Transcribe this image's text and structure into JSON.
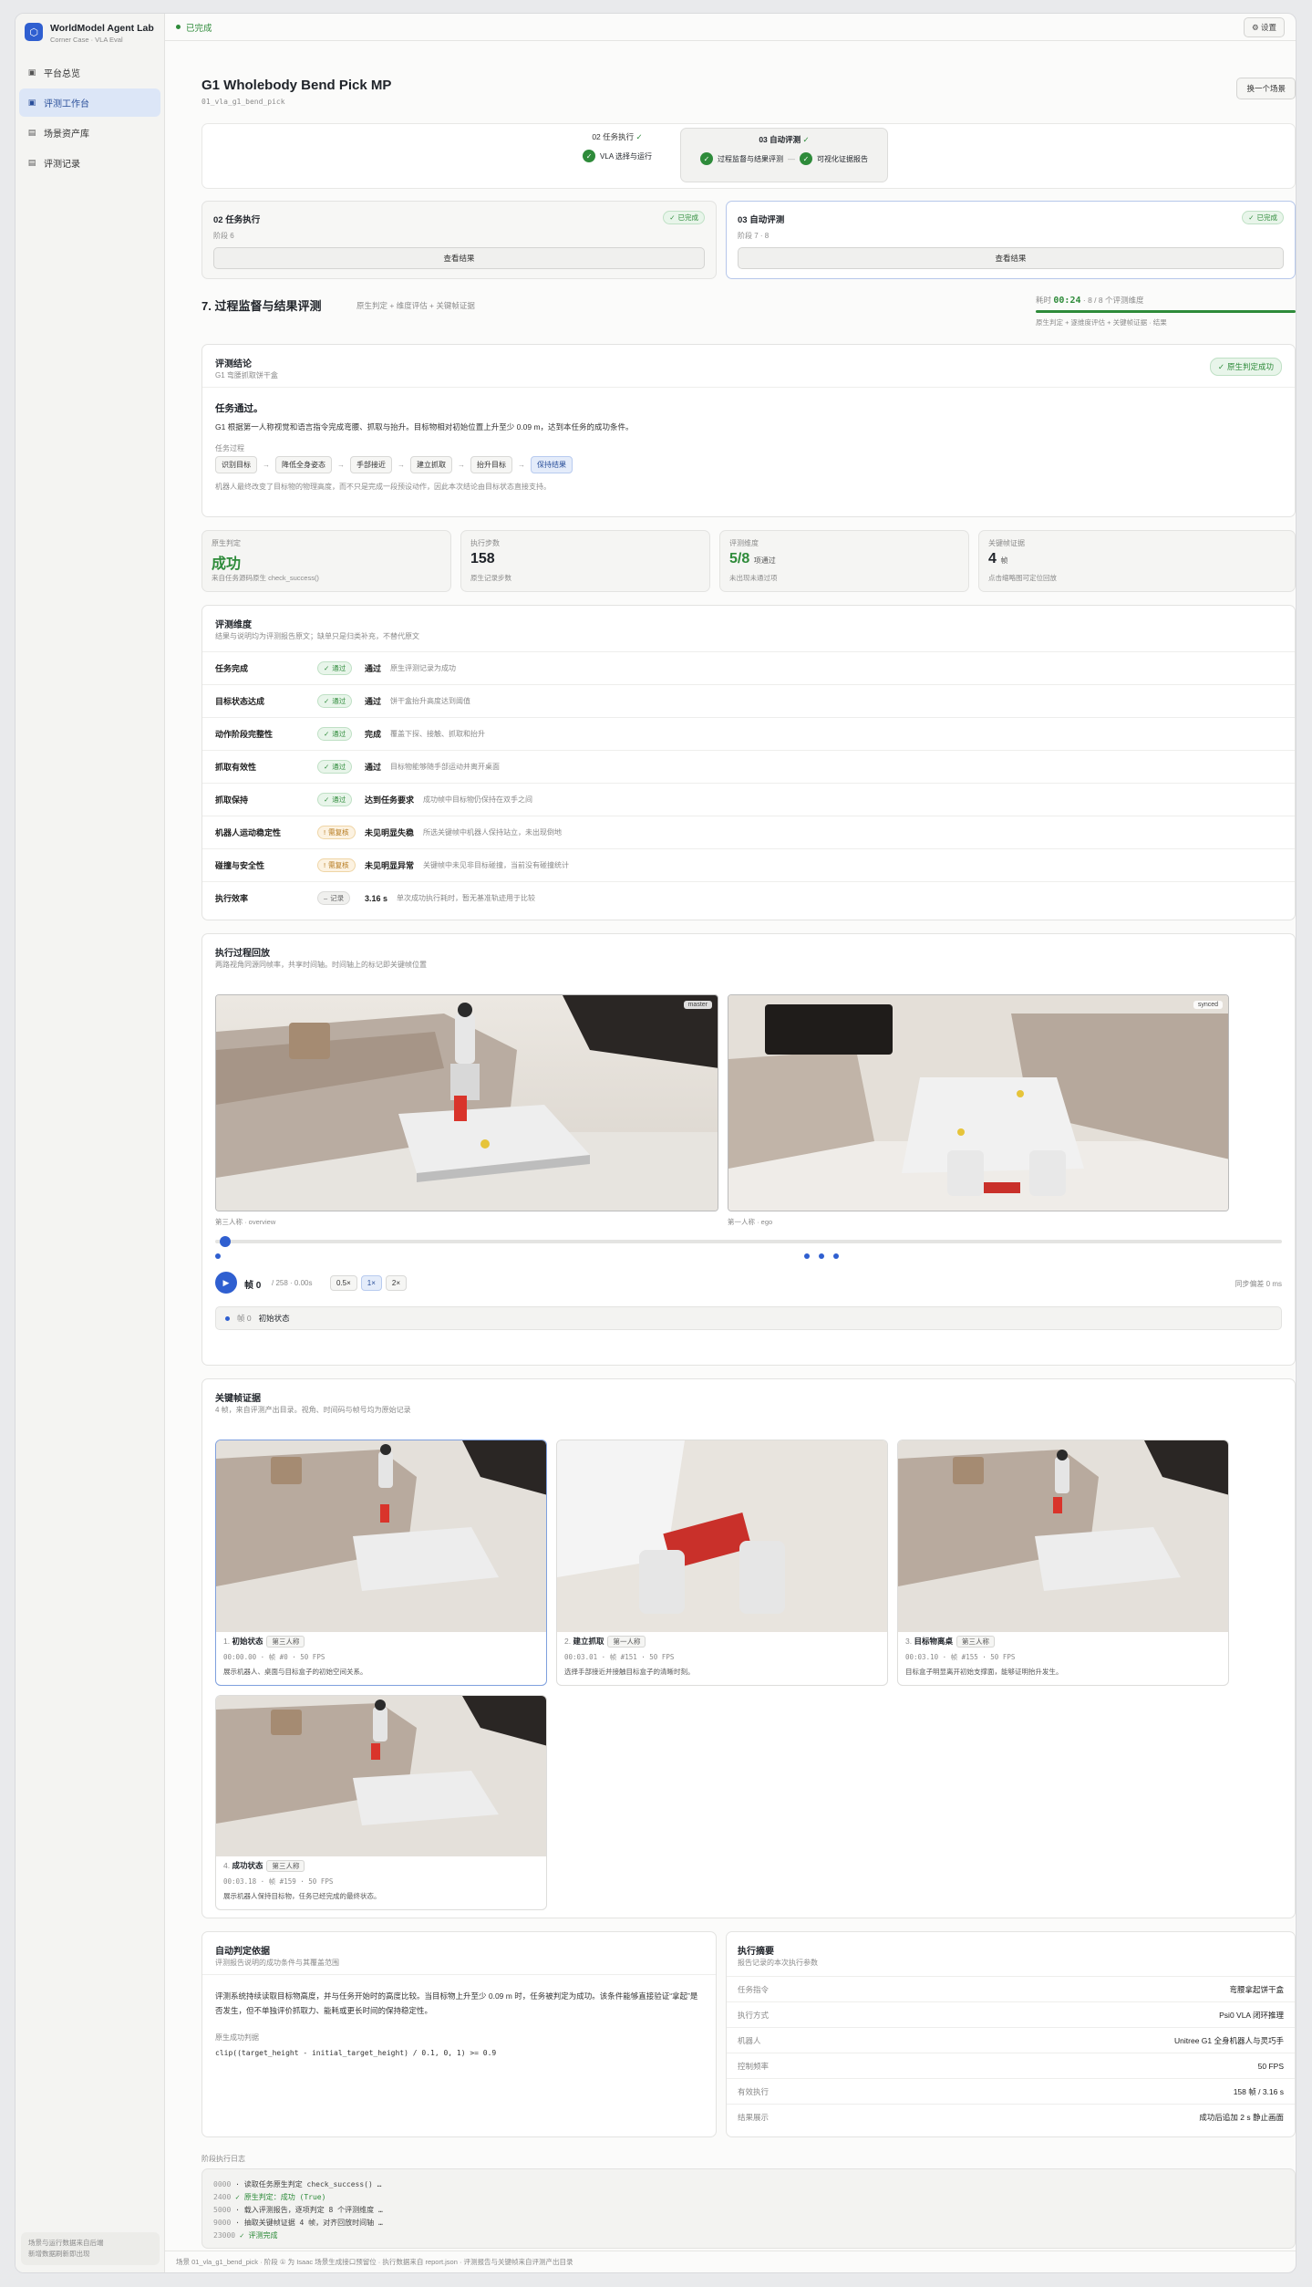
{
  "brand": {
    "name": "WorldModel Agent Lab",
    "sub": "Corner Case · VLA Eval",
    "logo_icon": "hexagon-icon"
  },
  "nav": [
    {
      "label": "平台总览",
      "icon": "calendar-icon"
    },
    {
      "label": "评测工作台",
      "icon": "monitor-icon",
      "active": true
    },
    {
      "label": "场景资产库",
      "icon": "grid-icon"
    },
    {
      "label": "评测记录",
      "icon": "list-icon"
    }
  ],
  "sidebar_footer": [
    "场景与运行数据来自后端",
    "新增数据刷新即出现"
  ],
  "topbar": {
    "status": "已完成",
    "settings": "设置"
  },
  "header": {
    "title": "G1 Wholebody Bend Pick MP",
    "id": "01_vla_g1_bend_pick",
    "change_btn": "换一个场景"
  },
  "pipeline": {
    "step2": {
      "label": "02 任务执行",
      "sub": "VLA 选择与运行"
    },
    "step3": {
      "label": "03 自动评测",
      "sub1": "过程监督与结果评测",
      "sub2": "可视化证据报告"
    }
  },
  "stage_cards": [
    {
      "title": "02 任务执行",
      "badge": "已完成",
      "sub": "阶段 6",
      "btn": "查看结果"
    },
    {
      "title": "03 自动评测",
      "badge": "已完成",
      "sub": "阶段 7 · 8",
      "btn": "查看结果"
    }
  ],
  "section7": {
    "title": "7. 过程监督与结果评测",
    "sub": "原生判定 + 维度评估 + 关键帧证据",
    "timer_label": "耗时",
    "timer": "00:24",
    "timer_count": "· 8 / 8 个评测维度",
    "timer_sub": "原生判定 + 逐维度评估 + 关键帧证据 · 结果"
  },
  "conclusion": {
    "label": "评测结论",
    "task": "G1 弯腰抓取饼干盒",
    "badge": "原生判定成功",
    "headline": "任务通过。",
    "desc": "G1 根据第一人称视觉和语言指令完成弯腰、抓取与抬升。目标物相对初始位置上升至少 0.09 m，达到本任务的成功条件。",
    "process_label": "任务过程",
    "steps": [
      "识别目标",
      "降低全身姿态",
      "手部接近",
      "建立抓取",
      "抬升目标",
      "保持结果"
    ],
    "note": "机器人最终改变了目标物的物理高度，而不只是完成一段预设动作，因此本次结论由目标状态直接支持。"
  },
  "stats": [
    {
      "label": "原生判定",
      "value": "成功",
      "sub": "来自任务源码原生 check_success()",
      "color": "#2e8b3a"
    },
    {
      "label": "执行步数",
      "value": "158",
      "sub": "原生记录步数"
    },
    {
      "label": "评测维度",
      "value": "5/8",
      "value_suffix": "项通过",
      "sub": "未出现未通过项",
      "color": "#2e8b3a"
    },
    {
      "label": "关键帧证据",
      "value": "4",
      "value_suffix": "帧",
      "sub": "点击缩略图可定位回放"
    }
  ],
  "dimensions": {
    "label": "评测维度",
    "sub": "结果与说明均为评测报告原文；缺单只是归类补充，不替代原文",
    "rows": [
      {
        "name": "任务完成",
        "tag": "通过",
        "kind": "ok",
        "verdict": "通过",
        "desc": "原生评测记录为成功"
      },
      {
        "name": "目标状态达成",
        "tag": "通过",
        "kind": "ok",
        "verdict": "通过",
        "desc": "饼干盒抬升高度达到阈值"
      },
      {
        "name": "动作阶段完整性",
        "tag": "通过",
        "kind": "ok",
        "verdict": "完成",
        "desc": "覆盖下探、接触、抓取和抬升"
      },
      {
        "name": "抓取有效性",
        "tag": "通过",
        "kind": "ok",
        "verdict": "通过",
        "desc": "目标物能够随手部运动并离开桌面"
      },
      {
        "name": "抓取保持",
        "tag": "通过",
        "kind": "ok",
        "verdict": "达到任务要求",
        "desc": "成功帧中目标物仍保持在双手之间"
      },
      {
        "name": "机器人运动稳定性",
        "tag": "需复核",
        "kind": "warn",
        "verdict": "未见明显失稳",
        "desc": "所选关键帧中机器人保持站立，未出现倒地"
      },
      {
        "name": "碰撞与安全性",
        "tag": "需复核",
        "kind": "warn",
        "verdict": "未见明显异常",
        "desc": "关键帧中未见非目标碰撞，当前没有碰撞统计"
      },
      {
        "name": "执行效率",
        "tag": "记录",
        "kind": "neutral",
        "verdict": "3.16 s",
        "desc": "单次成功执行耗时，暂无基准轨迹用于比较"
      }
    ]
  },
  "playback": {
    "label": "执行过程回放",
    "sub": "两路视角同源同帧率，共享时间轴。时间轴上的标记即关键帧位置",
    "view1_tag": "master",
    "view2_tag": "synced",
    "view1_caption": "第三人称 · overview",
    "view2_caption": "第一人称 · ego",
    "frame_label": "帧 0",
    "frame_total": "/ 258 · 0.00s",
    "speeds": [
      "0.5×",
      "1×",
      "2×"
    ],
    "offset": "同步偏差 0 ms",
    "status_frame": "帧 0",
    "status_text": "初始状态"
  },
  "keyframes": {
    "label": "关键帧证据",
    "sub": "4 帧，来自评测产出目录。视角、时间码与帧号均为原始记录",
    "items": [
      {
        "idx": "1.",
        "title": "初始状态",
        "cam": "第三人称",
        "meta": "00:00.00 · 帧 #0 · 50 FPS",
        "desc": "展示机器人、桌面与目标盒子的初始空间关系。"
      },
      {
        "idx": "2.",
        "title": "建立抓取",
        "cam": "第一人称",
        "meta": "00:03.01 · 帧 #151 · 50 FPS",
        "desc": "选择手部接近并接触目标盒子的清晰时刻。"
      },
      {
        "idx": "3.",
        "title": "目标物离桌",
        "cam": "第三人称",
        "meta": "00:03.10 · 帧 #155 · 50 FPS",
        "desc": "目标盒子明显离开初始支撑面，能够证明抬升发生。"
      },
      {
        "idx": "4.",
        "title": "成功状态",
        "cam": "第三人称",
        "meta": "00:03.18 · 帧 #159 · 50 FPS",
        "desc": "展示机器人保持目标物，任务已经完成的最终状态。"
      }
    ]
  },
  "judge": {
    "label": "自动判定依据",
    "sub": "评测报告说明的成功条件与其覆盖范围",
    "text": "评测系统持续读取目标物高度，并与任务开始时的高度比较。当目标物上升至少 0.09 m 时，任务被判定为成功。该条件能够直接验证“拿起”是否发生，但不单独评价抓取力、能耗或更长时间的保持稳定性。",
    "formula_label": "原生成功判据",
    "formula": "clip((target_height - initial_target_height) / 0.1, 0, 1) >= 0.9"
  },
  "exec_summary": {
    "label": "执行摘要",
    "sub": "报告记录的本次执行参数",
    "rows": [
      {
        "k": "任务指令",
        "v": "弯腰拿起饼干盒"
      },
      {
        "k": "执行方式",
        "v": "Psi0 VLA 闭环推理"
      },
      {
        "k": "机器人",
        "v": "Unitree G1 全身机器人与灵巧手"
      },
      {
        "k": "控制频率",
        "v": "50 FPS"
      },
      {
        "k": "有效执行",
        "v": "158 帧 / 3.16 s"
      },
      {
        "k": "结果展示",
        "v": "成功后追加 2 s 静止画面"
      }
    ]
  },
  "log": {
    "label": "阶段执行日志",
    "lines": [
      {
        "t": "0000",
        "txt": "· 读取任务原生判定 check_success() …",
        "ok": false
      },
      {
        "t": "2400",
        "txt": "✓ 原生判定：成功 (True)",
        "ok": true
      },
      {
        "t": "5000",
        "txt": "· 载入评测报告，逐项判定 8 个评测维度 …",
        "ok": false
      },
      {
        "t": "9000",
        "txt": "· 抽取关键帧证据 4 帧，对齐回放时间轴 …",
        "ok": false
      },
      {
        "t": "23000",
        "txt": "✓ 评测完成",
        "ok": true
      }
    ]
  },
  "pagebar": "场景 01_vla_g1_bend_pick · 阶段 ① 为 Isaac 场景生成接口预留位 · 执行数据来自 report.json · 评测报告与关键帧来自评测产出目录"
}
